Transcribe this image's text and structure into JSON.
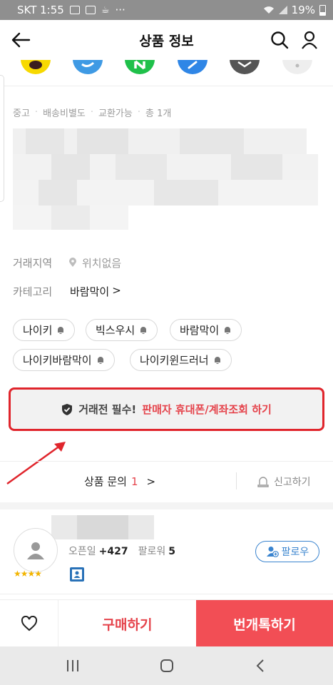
{
  "status_bar": {
    "carrier_time": "SKT 1:55",
    "more": "···",
    "battery": "19%"
  },
  "header": {
    "title": "상품 정보"
  },
  "meta": {
    "items": [
      "중고",
      "배송비별도",
      "교환가능",
      "총 1개"
    ],
    "separator": "·"
  },
  "info": {
    "location_label": "거래지역",
    "location_value": "위치없음",
    "category_label": "카테고리",
    "category_value": "바람막이",
    "category_chevron": ">"
  },
  "tags": [
    "나이키",
    "빅스우시",
    "바람막이",
    "나이키바람막이",
    "나이키윈드러너"
  ],
  "verify": {
    "prefix": "거래전 필수!",
    "accent": "판매자 휴대폰/계좌조회 하기"
  },
  "inquiry": {
    "label": "상품 문의",
    "count": "1",
    "chevron": ">"
  },
  "report": {
    "label": "신고하기"
  },
  "seller": {
    "stats_label1": "오픈일",
    "stats_value1": "+427",
    "stats_label2": "팔로워",
    "stats_value2": "5",
    "stars": "★★★★",
    "follow_label": "팔로우"
  },
  "bottom": {
    "buy_label": "구매하기",
    "chat_label": "번개톡하기"
  },
  "colors": {
    "accent_red": "#e5434b",
    "chat_bg": "#f24e55",
    "follow_blue": "#3a84cf",
    "highlight_border": "#e0252c"
  },
  "icons": {
    "share": [
      "kakaotalk-icon",
      "twitter-icon",
      "naver-icon",
      "link-icon",
      "mail-icon",
      "more-icon"
    ],
    "header": [
      "back-arrow-icon",
      "search-icon",
      "user-icon"
    ]
  }
}
